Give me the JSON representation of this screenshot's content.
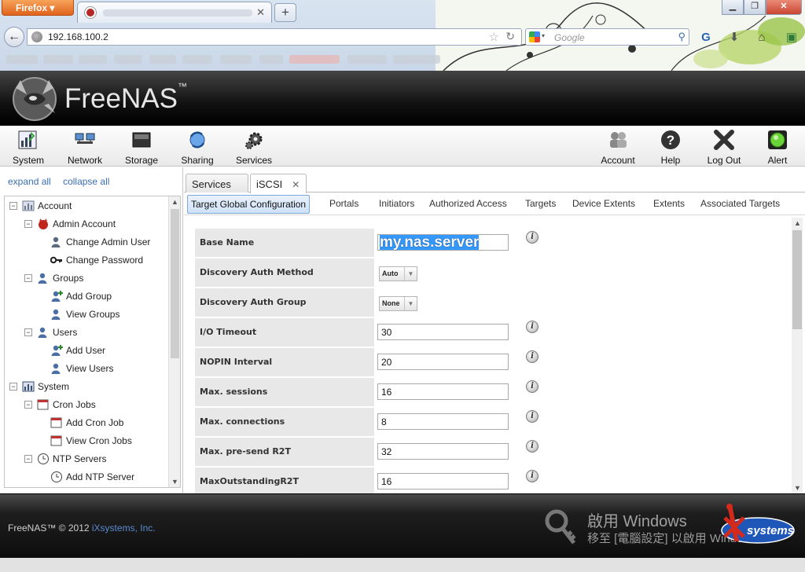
{
  "browser": {
    "app_button": "Firefox",
    "url": "192.168.100.2",
    "search_placeholder": "Google",
    "new_tab": "+",
    "tab_close": "✕"
  },
  "header": {
    "logo_text": "FreeNAS",
    "logo_tm": "™"
  },
  "topnav": {
    "left": [
      "System",
      "Network",
      "Storage",
      "Sharing",
      "Services"
    ],
    "right": [
      "Account",
      "Help",
      "Log Out",
      "Alert"
    ]
  },
  "sidebar": {
    "expand_all": "expand all",
    "collapse_all": "collapse all",
    "tree": [
      {
        "label": "Account",
        "level": 0,
        "toggle": "−",
        "icon": "account-icon"
      },
      {
        "label": "Admin Account",
        "level": 1,
        "toggle": "−",
        "icon": "freenas-devil-icon"
      },
      {
        "label": "Change Admin User",
        "level": 2,
        "icon": "edit-user-icon"
      },
      {
        "label": "Change Password",
        "level": 2,
        "icon": "key-icon"
      },
      {
        "label": "Groups",
        "level": 1,
        "toggle": "−",
        "icon": "groups-icon"
      },
      {
        "label": "Add Group",
        "level": 2,
        "icon": "add-group-icon"
      },
      {
        "label": "View Groups",
        "level": 2,
        "icon": "view-groups-icon"
      },
      {
        "label": "Users",
        "level": 1,
        "toggle": "−",
        "icon": "user-icon"
      },
      {
        "label": "Add User",
        "level": 2,
        "icon": "add-user-icon"
      },
      {
        "label": "View Users",
        "level": 2,
        "icon": "view-users-icon"
      },
      {
        "label": "System",
        "level": 0,
        "toggle": "−",
        "icon": "system-icon"
      },
      {
        "label": "Cron Jobs",
        "level": 1,
        "toggle": "−",
        "icon": "calendar-icon"
      },
      {
        "label": "Add Cron Job",
        "level": 2,
        "icon": "add-calendar-icon"
      },
      {
        "label": "View Cron Jobs",
        "level": 2,
        "icon": "view-calendar-icon"
      },
      {
        "label": "NTP Servers",
        "level": 1,
        "toggle": "−",
        "icon": "clock-icon"
      },
      {
        "label": "Add NTP Server",
        "level": 2,
        "icon": "add-clock-icon"
      }
    ]
  },
  "main": {
    "tabs": [
      {
        "label": "Services",
        "active": false
      },
      {
        "label": "iSCSI",
        "active": true,
        "close": "✕"
      }
    ],
    "subtabs": [
      "Target Global Configuration",
      "Portals",
      "Initiators",
      "Authorized Access",
      "Targets",
      "Device Extents",
      "Extents",
      "Associated Targets"
    ],
    "form": [
      {
        "label": "Base Name",
        "type": "text",
        "value": "my.nas.server",
        "highlighted": true,
        "info": true
      },
      {
        "label": "Discovery Auth Method",
        "type": "select",
        "value": "Auto",
        "info": false
      },
      {
        "label": "Discovery Auth Group",
        "type": "select",
        "value": "None",
        "info": false
      },
      {
        "label": "I/O Timeout",
        "type": "text",
        "value": "30",
        "info": true
      },
      {
        "label": "NOPIN Interval",
        "type": "text",
        "value": "20",
        "info": true
      },
      {
        "label": "Max. sessions",
        "type": "text",
        "value": "16",
        "info": true
      },
      {
        "label": "Max. connections",
        "type": "text",
        "value": "8",
        "info": true
      },
      {
        "label": "Max. pre-send R2T",
        "type": "text",
        "value": "32",
        "info": true
      },
      {
        "label": "MaxOutstandingR2T",
        "type": "text",
        "value": "16",
        "info": true
      }
    ],
    "info_glyph": "i"
  },
  "footer": {
    "copyright": "FreeNAS™ © 2012 ",
    "company": "iXsystems, Inc.",
    "activation_line1": "啟用 Windows",
    "activation_line2": "移至 [電腦設定] 以啟用 Windows。",
    "brand_logo": "systems"
  },
  "colors": {
    "header_bg": "#000000",
    "link_blue": "#3a6fb5",
    "selection_blue": "#3399ff",
    "row_bg": "#e8e8e8"
  }
}
